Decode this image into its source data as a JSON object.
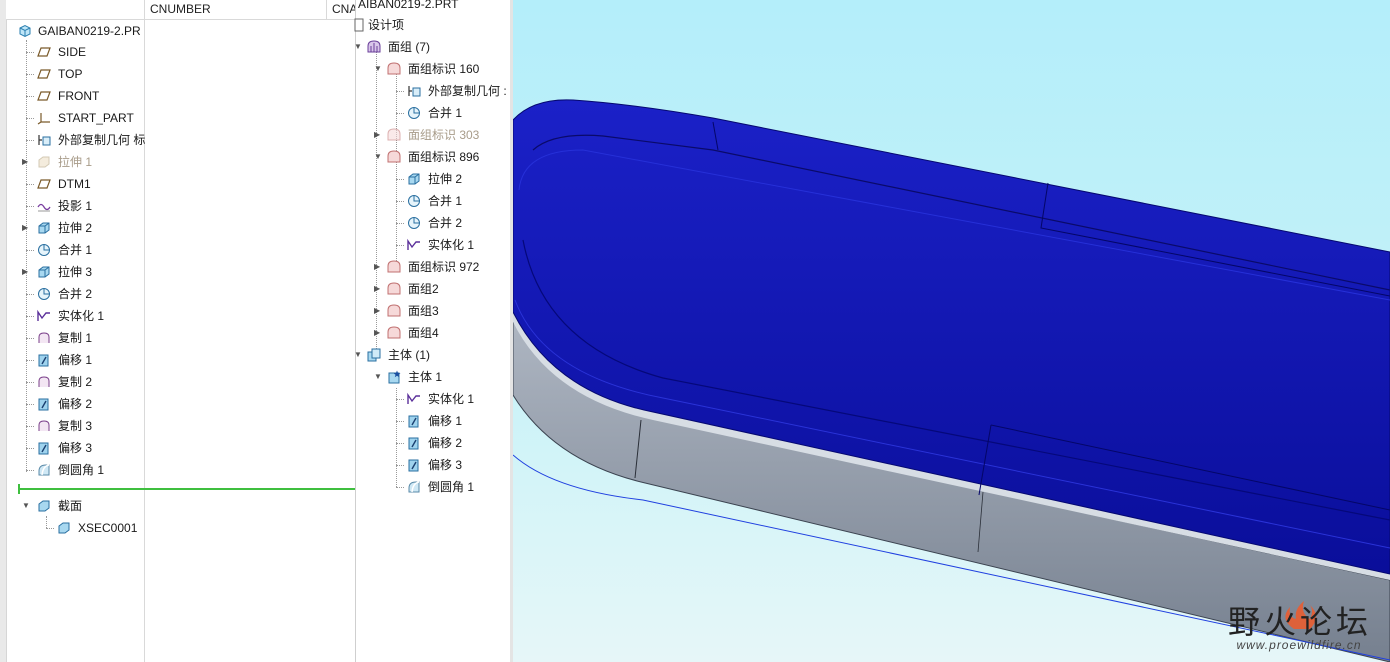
{
  "left_tree": {
    "columns": [
      "CNUMBER",
      "CNA"
    ],
    "root_label": "GAIBAN0219-2.PR",
    "items": [
      {
        "label": "SIDE"
      },
      {
        "label": "TOP"
      },
      {
        "label": "FRONT"
      },
      {
        "label": "START_PART"
      },
      {
        "label": "外部复制几何 标"
      },
      {
        "label": "拉伸 1"
      },
      {
        "label": "DTM1"
      },
      {
        "label": "投影 1"
      },
      {
        "label": "拉伸 2"
      },
      {
        "label": "合并 1"
      },
      {
        "label": "拉伸 3"
      },
      {
        "label": "合并 2"
      },
      {
        "label": "实体化 1"
      },
      {
        "label": "复制 1"
      },
      {
        "label": "偏移 1"
      },
      {
        "label": "复制 2"
      },
      {
        "label": "偏移 2"
      },
      {
        "label": "复制 3"
      },
      {
        "label": "偏移 3"
      },
      {
        "label": "倒圆角 1"
      }
    ],
    "section_label": "截面",
    "section_child": "XSEC0001"
  },
  "mid_tree": {
    "title": "AIBAN0219-2.PRT",
    "design_items": "设计项",
    "items": [
      {
        "label": "面组 (7)"
      },
      {
        "label": "面组标识 160"
      },
      {
        "label": "外部复制几何 :"
      },
      {
        "label": "合并 1"
      },
      {
        "label": "面组标识 303"
      },
      {
        "label": "面组标识 896"
      },
      {
        "label": "拉伸 2"
      },
      {
        "label": "合并 1"
      },
      {
        "label": "合并 2"
      },
      {
        "label": "实体化 1"
      },
      {
        "label": "面组标识 972"
      },
      {
        "label": "面组2"
      },
      {
        "label": "面组3"
      },
      {
        "label": "面组4"
      },
      {
        "label": "主体 (1)"
      },
      {
        "label": "主体 1"
      },
      {
        "label": "实体化 1"
      },
      {
        "label": "偏移 1"
      },
      {
        "label": "偏移 2"
      },
      {
        "label": "偏移 3"
      },
      {
        "label": "倒圆角 1"
      }
    ]
  },
  "watermark": {
    "title": "野火论坛",
    "url": "www.proewildfire.cn"
  },
  "colors": {
    "part_blue": "#0a0fb4",
    "part_gray": "#8a95a4",
    "sky": "#b4eefa",
    "insert_line": "#3fbf3f"
  }
}
